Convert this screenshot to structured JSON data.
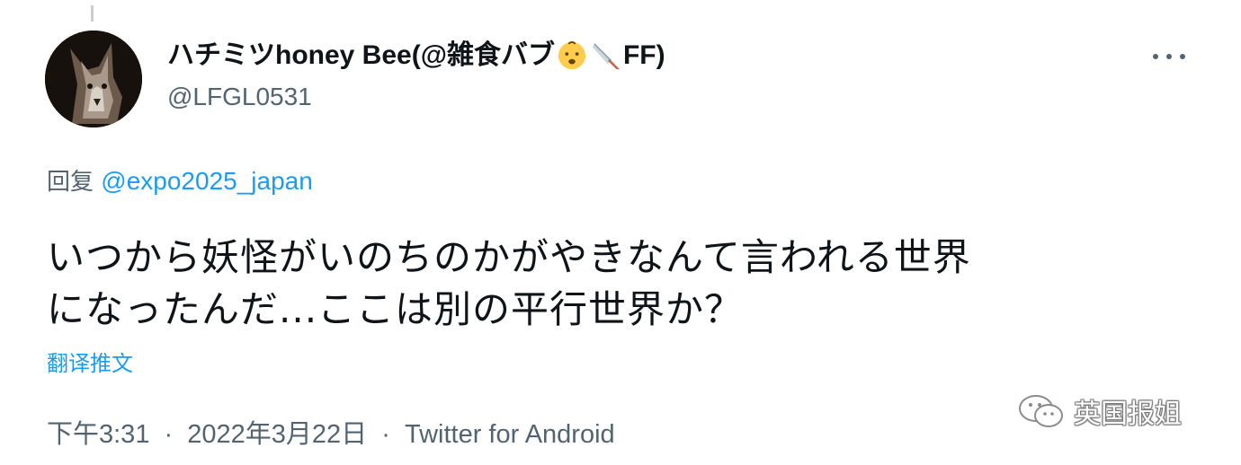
{
  "tweet": {
    "author": {
      "name_part1": "ハチミツhoney Bee(@雑食バブ",
      "name_part2": "FF)",
      "name_emojis": [
        "baby-face-emoji",
        "kitchen-knife-emoji"
      ],
      "handle": "@LFGL0531"
    },
    "reply": {
      "prefix": "回复",
      "mention": "@expo2025_japan"
    },
    "text_lines": [
      "いつから妖怪がいのちのかがやきなんて言われる世界",
      "になったんだ...ここは別の平行世界か？"
    ],
    "translate_label": "翻译推文",
    "meta": {
      "time": "下午3:31",
      "date": "2022年3月22日",
      "separator": "·",
      "source": "Twitter for Android"
    },
    "more_icon": "more-horizontal-icon"
  },
  "watermark": {
    "text": "英国报姐",
    "icon": "wechat-icon"
  },
  "colors": {
    "text_primary": "#0f1419",
    "text_secondary": "#536471",
    "link": "#1d9bf0",
    "background": "#ffffff"
  }
}
